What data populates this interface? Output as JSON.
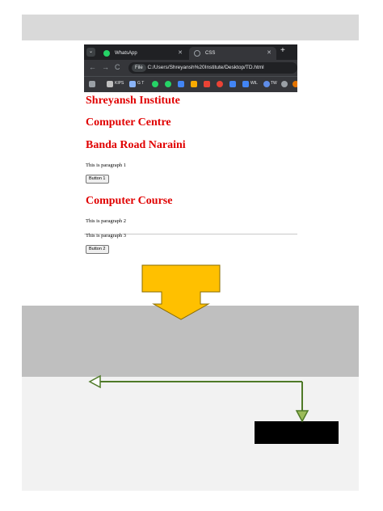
{
  "browser": {
    "tabs": [
      {
        "label": "WhatsApp",
        "active": false
      },
      {
        "label": "CSS",
        "active": true
      }
    ],
    "address": {
      "chip": "File",
      "url": "C:/Users/Shreyansh%20Institute/Desktop/TD.html"
    },
    "bookmarks": [
      "KIPS",
      "G T",
      "WIL",
      "TW"
    ]
  },
  "page": {
    "heading1": "Shreyansh Institute",
    "heading2": "Computer Centre",
    "heading3": "Banda Road Naraini",
    "paragraph1": "This is paragraph 1",
    "button1": "Button 1",
    "heading4": "Computer Course",
    "paragraph2": "This is paragraph 2",
    "paragraph3": "This is paragraph 3",
    "button2": "Button 2"
  },
  "colors": {
    "heading": "#e00000",
    "arrow_fill": "#ffc000",
    "connector": "#4f7a28"
  }
}
